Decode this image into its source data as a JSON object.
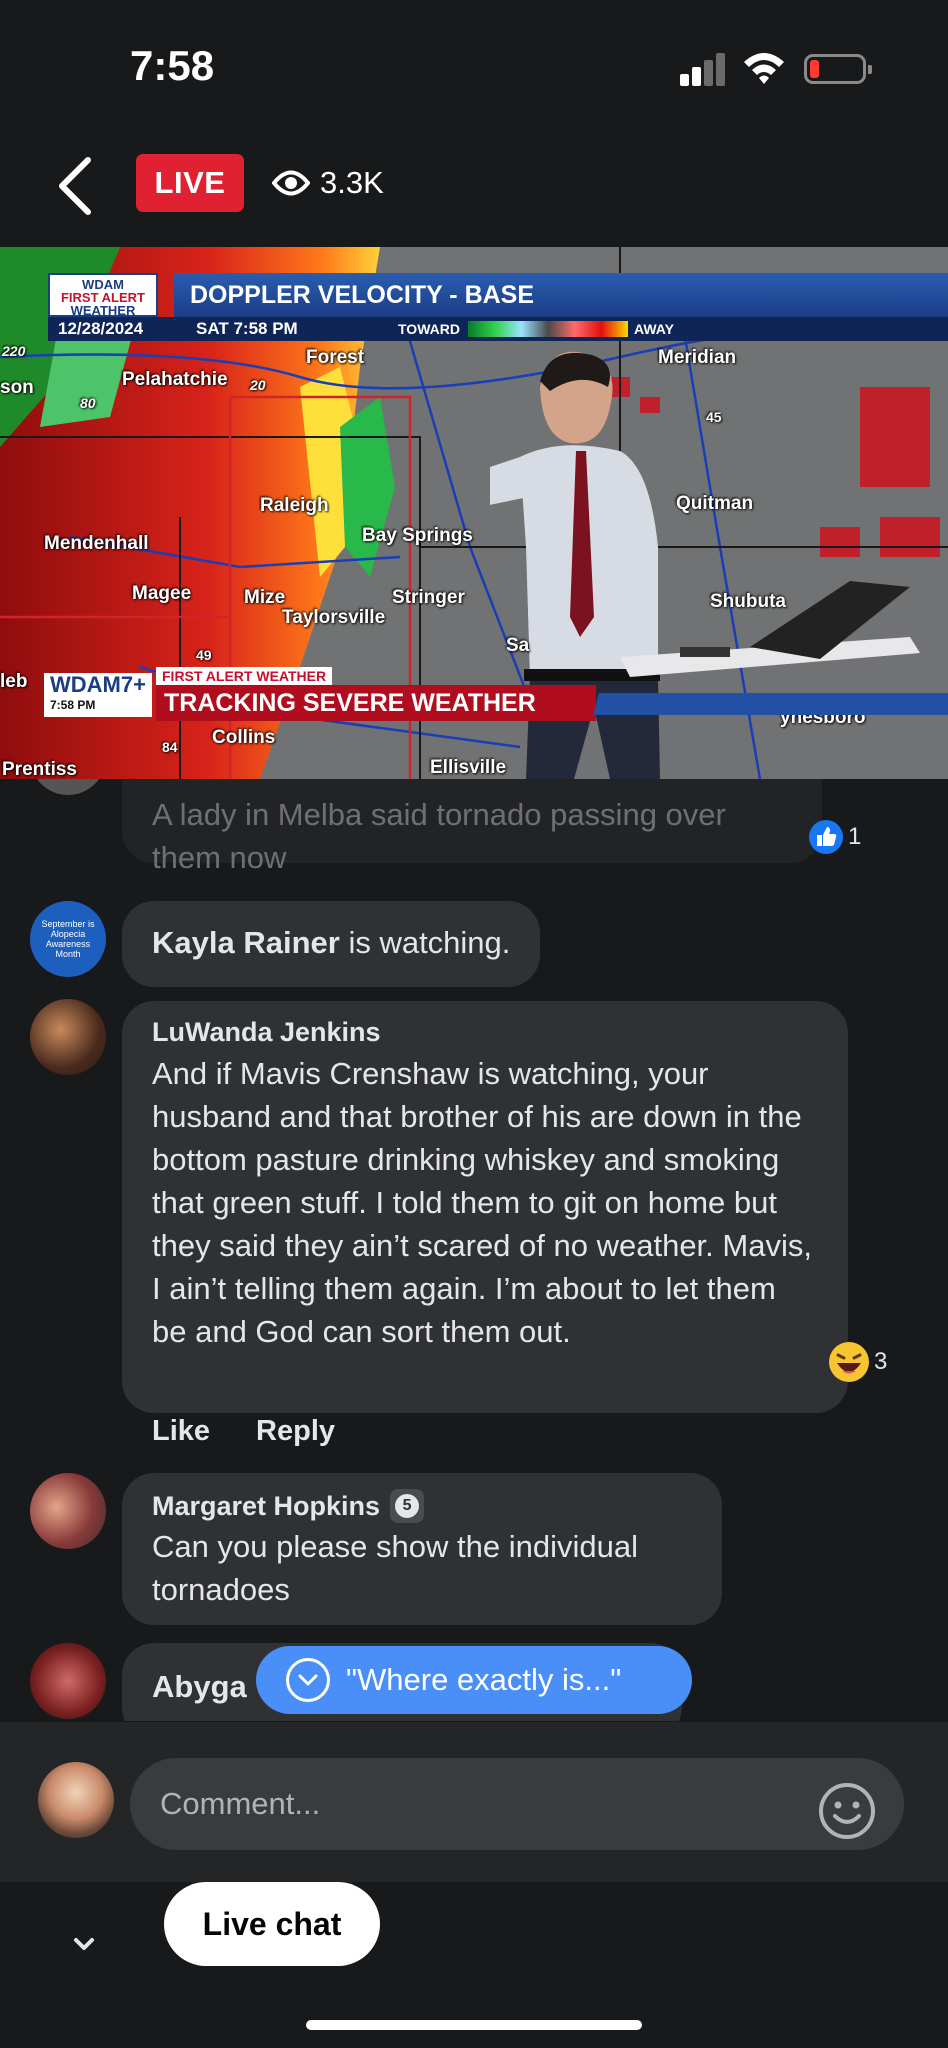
{
  "status_bar": {
    "time": "7:58",
    "icons": [
      "signal-icon",
      "wifi-icon",
      "battery-icon"
    ],
    "battery_color": "#ff3b30"
  },
  "header": {
    "live_label": "LIVE",
    "viewer_count": "3.3K",
    "icons": [
      "back-arrow-icon",
      "eye-icon"
    ],
    "live_color": "#e02131"
  },
  "video": {
    "logo_top": "WDAM",
    "logo_first_alert": "FIRST ALERT",
    "logo_weather": "WEATHER",
    "title": "DOPPLER VELOCITY - BASE",
    "date": "12/28/2024",
    "day_time": "SAT  7:58 PM",
    "toward": "TOWARD",
    "away": "AWAY",
    "lower_logo": "WDAM7+",
    "lower_time": "7:58 PM",
    "lower_tag": "FIRST ALERT WEATHER",
    "lower_headline": "TRACKING SEVERE WEATHER",
    "places": {
      "forest": "Forest",
      "meridian": "Meridian",
      "pelahatchie": "Pelahatchie",
      "son": "son",
      "raleigh": "Raleigh",
      "bay_springs": "Bay Springs",
      "quitman": "Quitman",
      "mendenhall": "Mendenhall",
      "magee": "Magee",
      "mize": "Mize",
      "taylorsville": "Taylorsville",
      "stringer": "Stringer",
      "shubuta": "Shubuta",
      "collins": "Collins",
      "prentiss": "Prentiss",
      "ellisville": "Ellisville",
      "waynesboro": "ynesboro",
      "sa": "Sa",
      "leb": "leb",
      "hwy_220": "220",
      "hwy_80": "80",
      "hwy_20": "20",
      "hwy_45": "45",
      "hwy_49": "49",
      "hwy_84": "84"
    }
  },
  "chat": {
    "comments": [
      {
        "text": "A lady in Melba said tornado passing over them now",
        "reaction_count": "1",
        "reaction_icon": "like-icon"
      },
      {
        "avatar_text": "September is Alopecia Awareness Month",
        "name": "Kayla Rainer",
        "text": " is watching."
      },
      {
        "name": "LuWanda Jenkins",
        "text": "And if Mavis Crenshaw is watching, your husband and that brother of his are down in the bottom pasture drinking whiskey and smoking that green stuff. I told them to git on home but they said they ain’t scared of no weather. Mavis, I ain’t telling them again. I’m about to let them be and God can sort them out.",
        "reaction_count": "3",
        "reaction_icon": "haha-icon",
        "like_label": "Like",
        "reply_label": "Reply"
      },
      {
        "name": "Margaret Hopkins",
        "badge": "5",
        "text": "Can you please show the individual tornadoes"
      },
      {
        "name": "Abyga"
      }
    ],
    "jump_pill": "\"Where exactly is...\""
  },
  "composer": {
    "placeholder": "Comment...",
    "icons": [
      "emoji-icon"
    ]
  },
  "bottom": {
    "live_chat_label": "Live chat",
    "icons": [
      "chevron-down-icon"
    ]
  }
}
